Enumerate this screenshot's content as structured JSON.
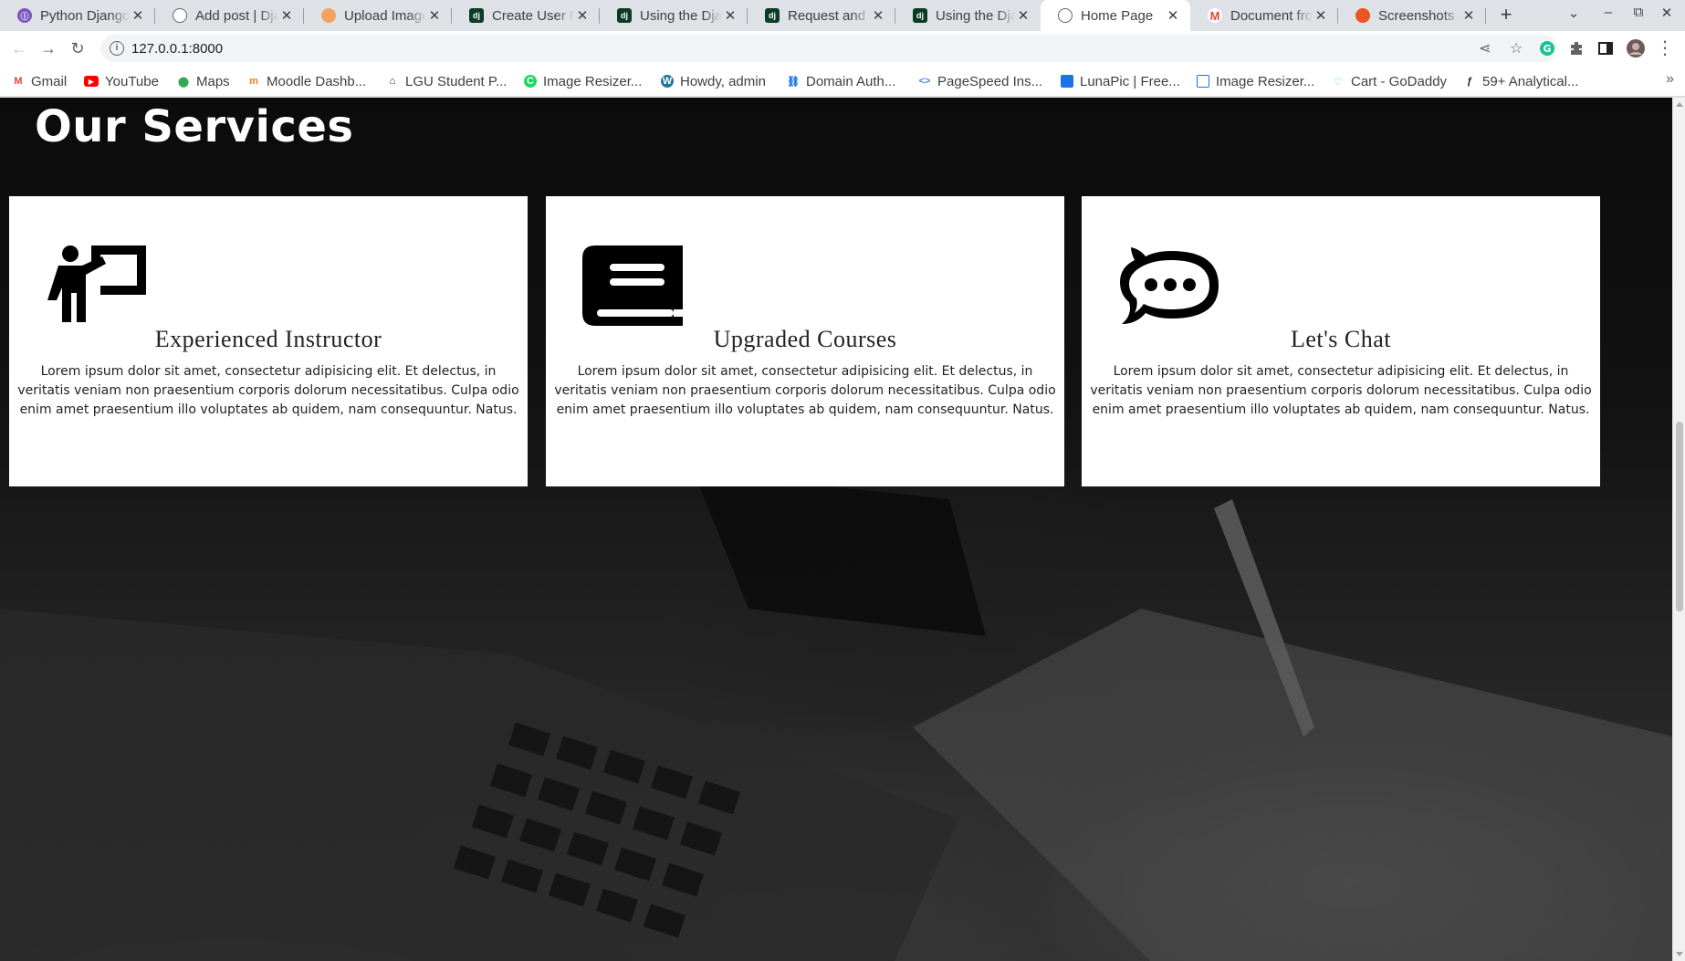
{
  "browser": {
    "tabs": [
      {
        "title": "Python Django",
        "favicon_color": "#7e57c2"
      },
      {
        "title": "Add post | Django",
        "favicon_color": "#5f6368"
      },
      {
        "title": "Upload Image",
        "favicon_color": "#f4a261"
      },
      {
        "title": "Create User Model",
        "favicon_color": "#0c3c26"
      },
      {
        "title": "Using the Django",
        "favicon_color": "#0c3c26"
      },
      {
        "title": "Request and response",
        "favicon_color": "#0c3c26"
      },
      {
        "title": "Using the Django",
        "favicon_color": "#0c3c26"
      },
      {
        "title": "Home Page",
        "favicon_color": "#5f6368",
        "active": true
      },
      {
        "title": "Document from",
        "favicon_color": "#ea4335"
      },
      {
        "title": "Screenshots and",
        "favicon_color": "#e95420"
      }
    ],
    "new_tab_label": "+",
    "url": "127.0.0.1:8000",
    "bookmarks": [
      {
        "label": "Gmail",
        "icon": "gmail-icon",
        "color": "#ea4335"
      },
      {
        "label": "YouTube",
        "icon": "youtube-icon",
        "color": "#ff0000"
      },
      {
        "label": "Maps",
        "icon": "maps-icon",
        "color": "#34a853"
      },
      {
        "label": "Moodle Dashb...",
        "icon": "moodle-icon",
        "color": "#f98012"
      },
      {
        "label": "LGU Student P...",
        "icon": "home-icon",
        "color": "#202124"
      },
      {
        "label": "Image Resizer...",
        "icon": "resizer-icon",
        "color": "#1ed760"
      },
      {
        "label": "Howdy, admin",
        "icon": "wordpress-icon",
        "color": "#21759b"
      },
      {
        "label": "Domain Auth...",
        "icon": "link-icon",
        "color": "#1a73e8"
      },
      {
        "label": "PageSpeed Ins...",
        "icon": "pagespeed-icon",
        "color": "#4285f4"
      },
      {
        "label": "LunaPic | Free...",
        "icon": "lunapic-icon",
        "color": "#1a73e8"
      },
      {
        "label": "Image Resizer...",
        "icon": "resizer-icon",
        "color": "#1a73e8"
      },
      {
        "label": "Cart - GoDaddy",
        "icon": "godaddy-icon",
        "color": "#1bdbdb"
      },
      {
        "label": "59+ Analytical...",
        "icon": "analytics-icon",
        "color": "#202124"
      }
    ]
  },
  "page": {
    "heading": "Our Services",
    "cards": [
      {
        "title": "Experienced Instructor",
        "icon": "instructor-icon",
        "text": "Lorem ipsum dolor sit amet, consectetur adipisicing elit. Et delectus, in veritatis veniam non praesentium corporis dolorum necessitatibus. Culpa odio enim amet praesentium illo voluptates ab quidem, nam consequuntur. Natus."
      },
      {
        "title": "Upgraded Courses",
        "icon": "book-icon",
        "text": "Lorem ipsum dolor sit amet, consectetur adipisicing elit. Et delectus, in veritatis veniam non praesentium corporis dolorum necessitatibus. Culpa odio enim amet praesentium illo voluptates ab quidem, nam consequuntur. Natus."
      },
      {
        "title": "Let's Chat",
        "icon": "chat-icon",
        "text": "Lorem ipsum dolor sit amet, consectetur adipisicing elit. Et delectus, in veritatis veniam non praesentium corporis dolorum necessitatibus. Culpa odio enim amet praesentium illo voluptates ab quidem, nam consequuntur. Natus."
      }
    ]
  }
}
